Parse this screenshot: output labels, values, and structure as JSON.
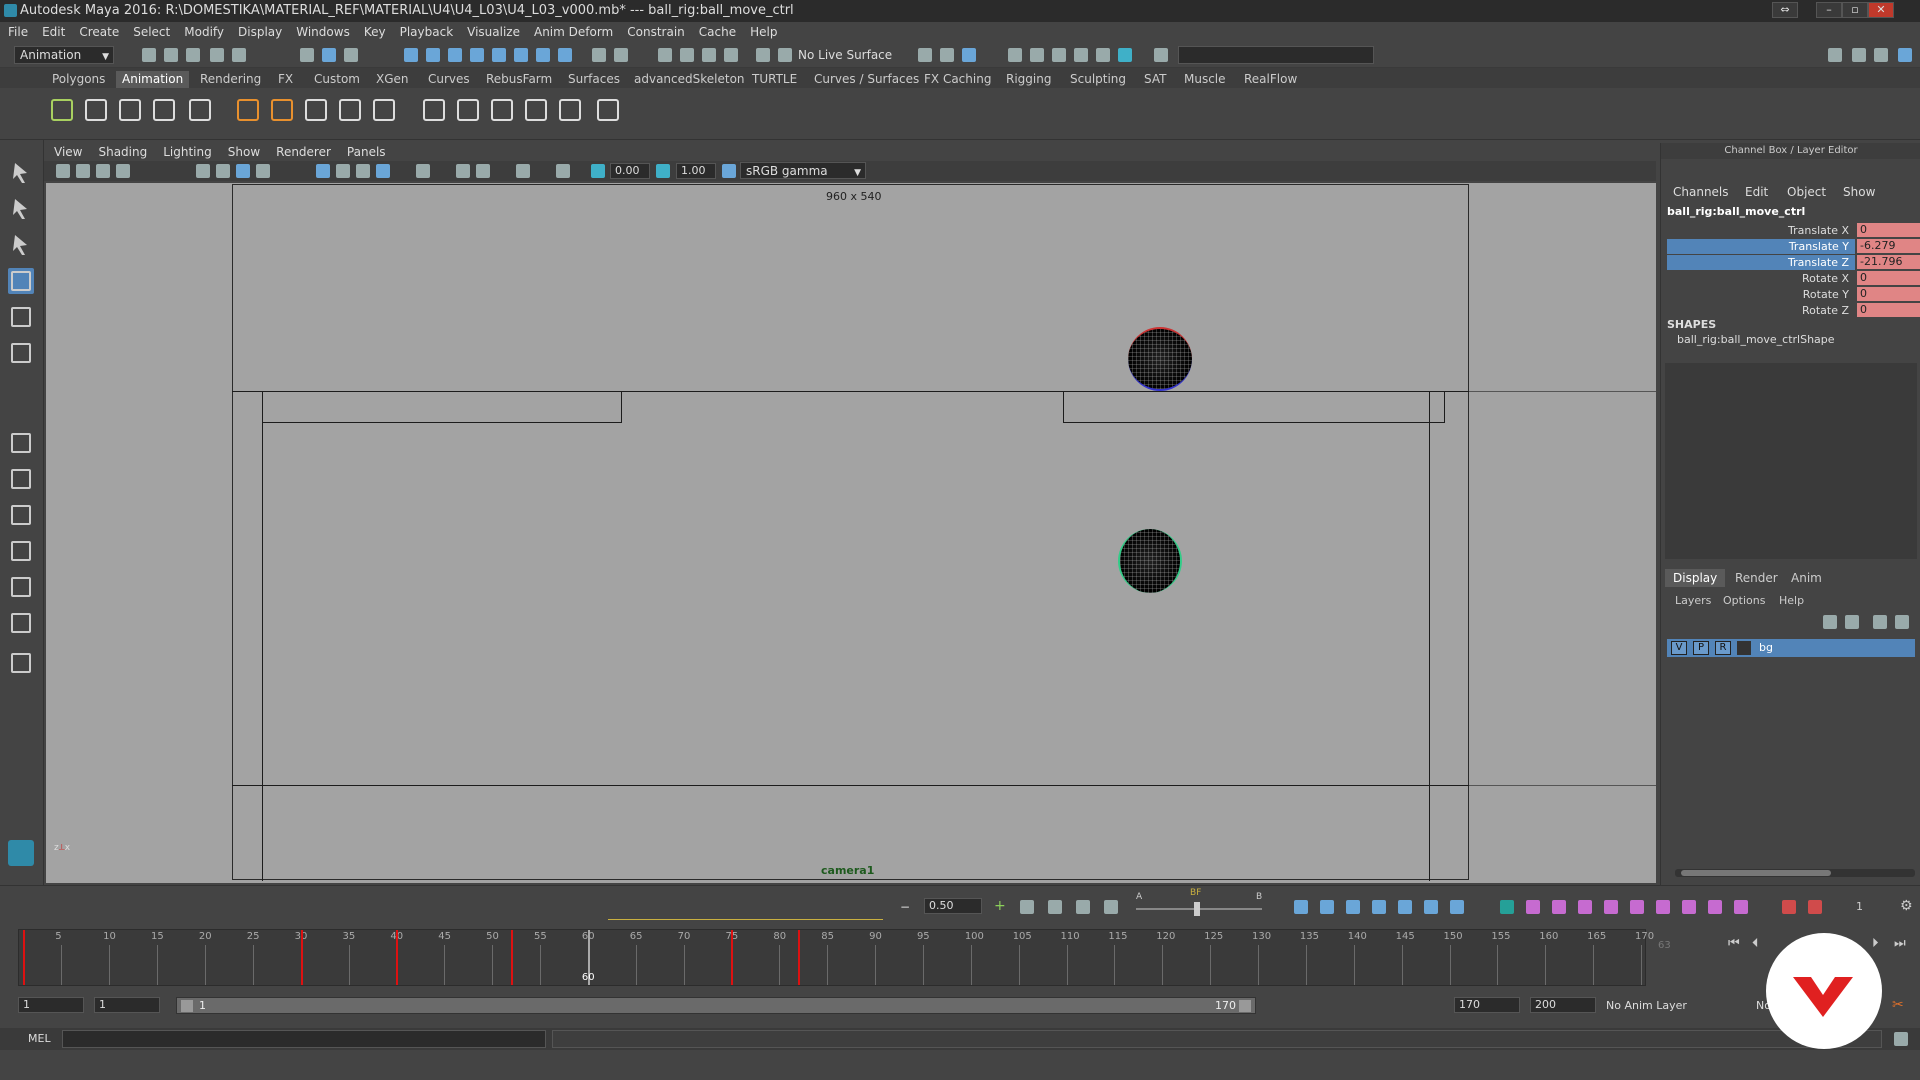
{
  "window": {
    "title": "Autodesk Maya 2016: R:\\DOMESTIKA\\MATERIAL_REF\\MATERIAL\\U4\\U4_L03\\U4_L03_v000.mb*   ---   ball_rig:ball_move_ctrl",
    "controls": [
      "⇔",
      "–",
      "▫",
      "✕"
    ]
  },
  "menubar": [
    "File",
    "Edit",
    "Create",
    "Select",
    "Modify",
    "Display",
    "Windows",
    "Key",
    "Playback",
    "Visualize",
    "Anim Deform",
    "Constrain",
    "Cache",
    "Help"
  ],
  "status_line": {
    "menu_set": "Animation",
    "live_surface": "No Live Surface"
  },
  "shelf_tabs": [
    "Polygons",
    "Animation",
    "Rendering",
    "FX",
    "Custom",
    "XGen",
    "Curves",
    "RebusFarm",
    "Surfaces",
    "advancedSkeleton",
    "TURTLE",
    "Curves / Surfaces",
    "FX Caching",
    "Rigging",
    "Sculpting",
    "SAT",
    "Muscle",
    "RealFlow"
  ],
  "active_shelf_tab": "Animation",
  "panel_menu": [
    "View",
    "Shading",
    "Lighting",
    "Show",
    "Renderer",
    "Panels"
  ],
  "panel_toolbar": {
    "exposure": "0.00",
    "gamma": "1.00",
    "color_space": "sRGB gamma"
  },
  "viewport": {
    "resolution_label": "960 x 540",
    "camera_name": "camera1"
  },
  "channel_box": {
    "header": "Channel Box / Layer Editor",
    "menus": [
      "Channels",
      "Edit",
      "Object",
      "Show"
    ],
    "object_name": "ball_rig:ball_move_ctrl",
    "attributes": [
      {
        "name": "Translate X",
        "value": "0",
        "highlighted": false
      },
      {
        "name": "Translate Y",
        "value": "-6.279",
        "highlighted": true
      },
      {
        "name": "Translate Z",
        "value": "-21.796",
        "highlighted": true
      },
      {
        "name": "Rotate X",
        "value": "0",
        "highlighted": false
      },
      {
        "name": "Rotate Y",
        "value": "0",
        "highlighted": false
      },
      {
        "name": "Rotate Z",
        "value": "0",
        "highlighted": false
      }
    ],
    "shapes_label": "SHAPES",
    "shape_name": "ball_rig:ball_move_ctrlShape"
  },
  "layer_editor": {
    "tabs": [
      "Display",
      "Render",
      "Anim"
    ],
    "menus": [
      "Layers",
      "Options",
      "Help"
    ],
    "layer": {
      "v": "V",
      "p": "P",
      "r": "R",
      "name": "bg"
    }
  },
  "graph_toolbar": {
    "value": "0.50",
    "a_label": "A",
    "bf_label": "BF",
    "b_label": "B",
    "step_value": "1"
  },
  "time_slider": {
    "labels": [
      "5",
      "10",
      "15",
      "20",
      "25",
      "30",
      "35",
      "40",
      "45",
      "50",
      "55",
      "60",
      "65",
      "70",
      "75",
      "80",
      "85",
      "90",
      "95",
      "100",
      "105",
      "110",
      "115",
      "120",
      "125",
      "130",
      "135",
      "140",
      "145",
      "150",
      "155",
      "160",
      "165",
      "170"
    ],
    "current_frame": "60",
    "side_field": "63",
    "keyframes": [
      1,
      30,
      40,
      52,
      60,
      75,
      82
    ]
  },
  "range_slider": {
    "start": "1",
    "playback_start": "1",
    "range_start_label": "1",
    "range_end_label": "170",
    "playback_end": "170",
    "end": "200",
    "anim_layer": "No Anim Layer",
    "char_set": "No"
  },
  "command_line": {
    "label": "MEL"
  },
  "colors": {
    "highlight": "#5284b8",
    "keyed": "#e08585",
    "key_tick": "#dd1111",
    "brand": "#e02020"
  }
}
